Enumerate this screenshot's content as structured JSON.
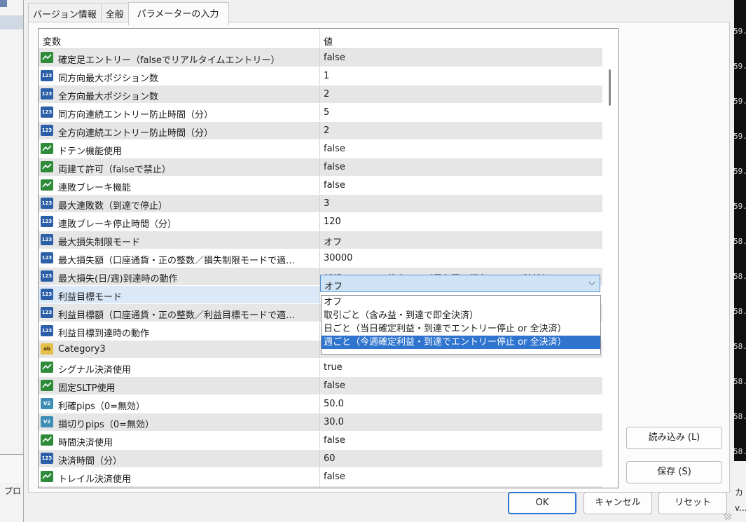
{
  "background": {
    "left_text": "プロ",
    "right_ticks": [
      "59.",
      "59.",
      "59.",
      "59.",
      "59.",
      "59.",
      "58.",
      "58.",
      "58.",
      "58.",
      "58.",
      "58.",
      "58.",
      "58."
    ],
    "right_panel": [
      "カ",
      "v..."
    ]
  },
  "tabs": [
    {
      "label": "バージョン情報"
    },
    {
      "label": "全般"
    },
    {
      "label": "パラメーターの入力"
    }
  ],
  "grid": {
    "header_name": "変数",
    "header_value": "値",
    "rows": [
      {
        "icon": "bool",
        "name": "確定足エントリー（falseでリアルタイムエントリー）",
        "value": "false"
      },
      {
        "icon": "int",
        "name": "同方向最大ポジション数",
        "value": "1"
      },
      {
        "icon": "int",
        "name": "全方向最大ポジション数",
        "value": "2"
      },
      {
        "icon": "int",
        "name": "同方向連続エントリー防止時間（分）",
        "value": "5"
      },
      {
        "icon": "int",
        "name": "全方向連続エントリー防止時間（分）",
        "value": "2"
      },
      {
        "icon": "bool",
        "name": "ドテン機能使用",
        "value": "false"
      },
      {
        "icon": "bool",
        "name": "両建て許可（falseで禁止）",
        "value": "false"
      },
      {
        "icon": "bool",
        "name": "連敗ブレーキ機能",
        "value": "false"
      },
      {
        "icon": "int",
        "name": "最大連敗数（到達で停止）",
        "value": "3"
      },
      {
        "icon": "int",
        "name": "連敗ブレーキ停止時間（分）",
        "value": "120"
      },
      {
        "icon": "int",
        "name": "最大損失制限モード",
        "value": "オフ"
      },
      {
        "icon": "int",
        "name": "最大損失額（口座通貨・正の整数／損失制限モードで適…",
        "value": "30000"
      },
      {
        "icon": "int",
        "name": "最大損失(日/週)到達時の動作",
        "value": "新規エントリー停止のみ（保有玉は既存ルールで決済）"
      },
      {
        "icon": "int",
        "name": "利益目標モード",
        "value": ""
      },
      {
        "icon": "int",
        "name": "利益目標額（口座通貨・正の整数／利益目標モードで適…",
        "value": ""
      },
      {
        "icon": "int",
        "name": "利益目標到達時の動作",
        "value": ""
      },
      {
        "icon": "str",
        "name": "Category3",
        "value": ""
      },
      {
        "icon": "bool",
        "name": "シグナル決済使用",
        "value": "true"
      },
      {
        "icon": "bool",
        "name": "固定SLTP使用",
        "value": "false"
      },
      {
        "icon": "dbl",
        "name": "利確pips（0=無効）",
        "value": "50.0"
      },
      {
        "icon": "dbl",
        "name": "損切りpips（0=無効）",
        "value": "30.0"
      },
      {
        "icon": "bool",
        "name": "時間決済使用",
        "value": "false"
      },
      {
        "icon": "int",
        "name": "決済時間（分）",
        "value": "60"
      },
      {
        "icon": "bool",
        "name": "トレイル決済使用",
        "value": "false"
      },
      {
        "icon": "dbl",
        "name": "トレイル開始pips",
        "value": "20.0"
      }
    ],
    "icon_text": {
      "bool": "",
      "int": "123",
      "dbl": "V2",
      "str": "ab"
    }
  },
  "combo": {
    "selected": "オフ",
    "options": [
      "オフ",
      "取引ごと（含み益・到達で即全決済）",
      "日ごと（当日確定利益・到達でエントリー停止 or 全決済）",
      "週ごと（今週確定利益・到達でエントリー停止 or 全決済）"
    ],
    "highlighted_index": 3
  },
  "buttons": {
    "load": "読み込み (L)",
    "save": "保存 (S)",
    "ok": "OK",
    "cancel": "キャンセル",
    "reset": "リセット"
  }
}
